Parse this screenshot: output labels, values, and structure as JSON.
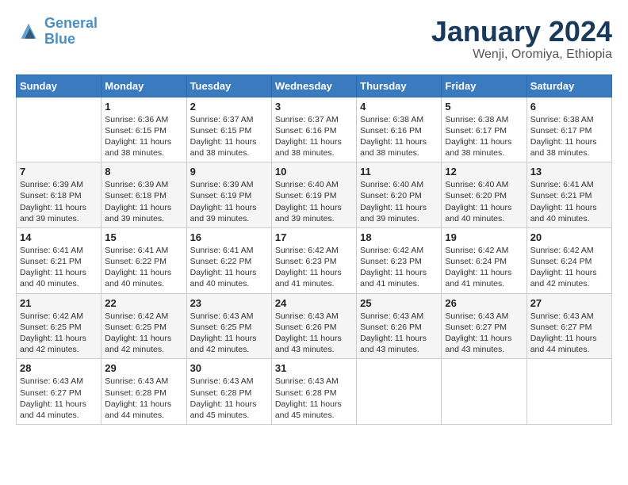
{
  "header": {
    "logo_line1": "General",
    "logo_line2": "Blue",
    "month_title": "January 2024",
    "subtitle": "Wenji, Oromiya, Ethiopia"
  },
  "days_of_week": [
    "Sunday",
    "Monday",
    "Tuesday",
    "Wednesday",
    "Thursday",
    "Friday",
    "Saturday"
  ],
  "weeks": [
    [
      {
        "day": "",
        "info": ""
      },
      {
        "day": "1",
        "info": "Sunrise: 6:36 AM\nSunset: 6:15 PM\nDaylight: 11 hours and 38 minutes."
      },
      {
        "day": "2",
        "info": "Sunrise: 6:37 AM\nSunset: 6:15 PM\nDaylight: 11 hours and 38 minutes."
      },
      {
        "day": "3",
        "info": "Sunrise: 6:37 AM\nSunset: 6:16 PM\nDaylight: 11 hours and 38 minutes."
      },
      {
        "day": "4",
        "info": "Sunrise: 6:38 AM\nSunset: 6:16 PM\nDaylight: 11 hours and 38 minutes."
      },
      {
        "day": "5",
        "info": "Sunrise: 6:38 AM\nSunset: 6:17 PM\nDaylight: 11 hours and 38 minutes."
      },
      {
        "day": "6",
        "info": "Sunrise: 6:38 AM\nSunset: 6:17 PM\nDaylight: 11 hours and 38 minutes."
      }
    ],
    [
      {
        "day": "7",
        "info": "Sunrise: 6:39 AM\nSunset: 6:18 PM\nDaylight: 11 hours and 39 minutes."
      },
      {
        "day": "8",
        "info": "Sunrise: 6:39 AM\nSunset: 6:18 PM\nDaylight: 11 hours and 39 minutes."
      },
      {
        "day": "9",
        "info": "Sunrise: 6:39 AM\nSunset: 6:19 PM\nDaylight: 11 hours and 39 minutes."
      },
      {
        "day": "10",
        "info": "Sunrise: 6:40 AM\nSunset: 6:19 PM\nDaylight: 11 hours and 39 minutes."
      },
      {
        "day": "11",
        "info": "Sunrise: 6:40 AM\nSunset: 6:20 PM\nDaylight: 11 hours and 39 minutes."
      },
      {
        "day": "12",
        "info": "Sunrise: 6:40 AM\nSunset: 6:20 PM\nDaylight: 11 hours and 40 minutes."
      },
      {
        "day": "13",
        "info": "Sunrise: 6:41 AM\nSunset: 6:21 PM\nDaylight: 11 hours and 40 minutes."
      }
    ],
    [
      {
        "day": "14",
        "info": "Sunrise: 6:41 AM\nSunset: 6:21 PM\nDaylight: 11 hours and 40 minutes."
      },
      {
        "day": "15",
        "info": "Sunrise: 6:41 AM\nSunset: 6:22 PM\nDaylight: 11 hours and 40 minutes."
      },
      {
        "day": "16",
        "info": "Sunrise: 6:41 AM\nSunset: 6:22 PM\nDaylight: 11 hours and 40 minutes."
      },
      {
        "day": "17",
        "info": "Sunrise: 6:42 AM\nSunset: 6:23 PM\nDaylight: 11 hours and 41 minutes."
      },
      {
        "day": "18",
        "info": "Sunrise: 6:42 AM\nSunset: 6:23 PM\nDaylight: 11 hours and 41 minutes."
      },
      {
        "day": "19",
        "info": "Sunrise: 6:42 AM\nSunset: 6:24 PM\nDaylight: 11 hours and 41 minutes."
      },
      {
        "day": "20",
        "info": "Sunrise: 6:42 AM\nSunset: 6:24 PM\nDaylight: 11 hours and 42 minutes."
      }
    ],
    [
      {
        "day": "21",
        "info": "Sunrise: 6:42 AM\nSunset: 6:25 PM\nDaylight: 11 hours and 42 minutes."
      },
      {
        "day": "22",
        "info": "Sunrise: 6:42 AM\nSunset: 6:25 PM\nDaylight: 11 hours and 42 minutes."
      },
      {
        "day": "23",
        "info": "Sunrise: 6:43 AM\nSunset: 6:25 PM\nDaylight: 11 hours and 42 minutes."
      },
      {
        "day": "24",
        "info": "Sunrise: 6:43 AM\nSunset: 6:26 PM\nDaylight: 11 hours and 43 minutes."
      },
      {
        "day": "25",
        "info": "Sunrise: 6:43 AM\nSunset: 6:26 PM\nDaylight: 11 hours and 43 minutes."
      },
      {
        "day": "26",
        "info": "Sunrise: 6:43 AM\nSunset: 6:27 PM\nDaylight: 11 hours and 43 minutes."
      },
      {
        "day": "27",
        "info": "Sunrise: 6:43 AM\nSunset: 6:27 PM\nDaylight: 11 hours and 44 minutes."
      }
    ],
    [
      {
        "day": "28",
        "info": "Sunrise: 6:43 AM\nSunset: 6:27 PM\nDaylight: 11 hours and 44 minutes."
      },
      {
        "day": "29",
        "info": "Sunrise: 6:43 AM\nSunset: 6:28 PM\nDaylight: 11 hours and 44 minutes."
      },
      {
        "day": "30",
        "info": "Sunrise: 6:43 AM\nSunset: 6:28 PM\nDaylight: 11 hours and 45 minutes."
      },
      {
        "day": "31",
        "info": "Sunrise: 6:43 AM\nSunset: 6:28 PM\nDaylight: 11 hours and 45 minutes."
      },
      {
        "day": "",
        "info": ""
      },
      {
        "day": "",
        "info": ""
      },
      {
        "day": "",
        "info": ""
      }
    ]
  ]
}
